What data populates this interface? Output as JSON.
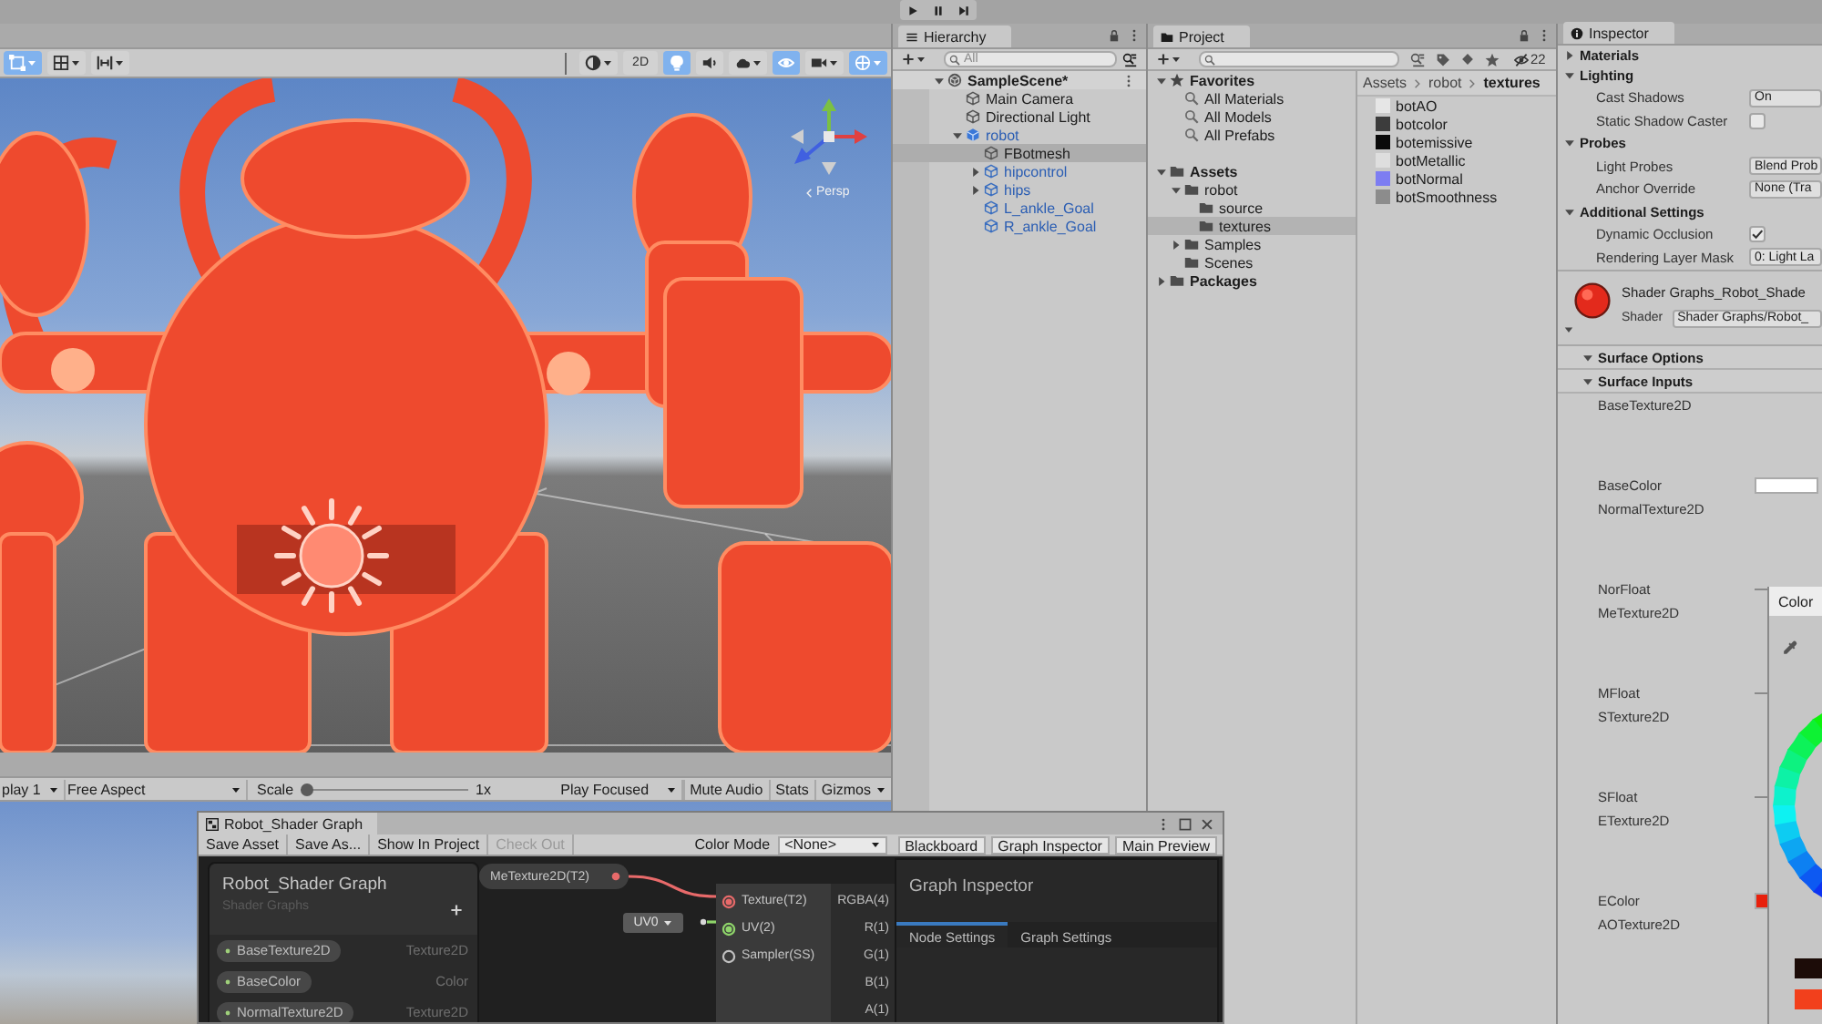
{
  "main_toolbar": {
    "play_buttons": [
      {
        "kind": "play",
        "selected": false
      },
      {
        "kind": "pause",
        "selected": false
      },
      {
        "kind": "step",
        "selected": false
      }
    ]
  },
  "scene_view": {
    "toolbar": {
      "left_tools": [
        {
          "kind": "rect",
          "selected": true
        },
        {
          "kind": "grid",
          "selected": false
        },
        {
          "kind": "snap",
          "selected": false
        }
      ],
      "right_tools": [
        {
          "kind": "shading",
          "selected": false
        },
        {
          "kind": "dimension",
          "label": "2D",
          "selected": false
        },
        {
          "kind": "lighting",
          "selected": true
        },
        {
          "kind": "audio",
          "selected": false
        },
        {
          "kind": "effects",
          "selected": false
        },
        {
          "kind": "visibility",
          "selected": true
        },
        {
          "kind": "camera",
          "selected": false
        },
        {
          "kind": "gizmos",
          "selected": true
        }
      ]
    },
    "projection": "Persp"
  },
  "game_view": {
    "toolbar": {
      "display": "play 1",
      "aspect": "Free Aspect",
      "scale": {
        "label": "Scale",
        "level": 0,
        "value": "1x"
      },
      "play_mode": "Play Focused",
      "buttons": [
        {
          "label": "Mute Audio",
          "kind": "toggle"
        },
        {
          "label": "Stats",
          "kind": "toggle"
        },
        {
          "label": "Gizmos",
          "kind": "dropdown"
        }
      ]
    }
  },
  "hierarchy": {
    "title": "Hierarchy",
    "search": {
      "placeholder": "All"
    },
    "items": [
      {
        "name": "SampleScene*",
        "kind": "scene",
        "expanded": true,
        "selected": false,
        "children": [
          {
            "name": "Main Camera",
            "kind": "object",
            "selected": false
          },
          {
            "name": "Directional Light",
            "kind": "object",
            "selected": false
          },
          {
            "name": "robot",
            "kind": "prefab",
            "expanded": true,
            "selected": false,
            "children": [
              {
                "name": "FBotmesh",
                "kind": "object",
                "selected": true
              },
              {
                "name": "hipcontrol",
                "kind": "nested",
                "expanded": false,
                "selected": false
              },
              {
                "name": "hips",
                "kind": "nested",
                "expanded": false,
                "selected": false
              },
              {
                "name": "L_ankle_Goal",
                "kind": "nested",
                "selected": false
              },
              {
                "name": "R_ankle_Goal",
                "kind": "nested",
                "selected": false
              }
            ]
          }
        ]
      }
    ]
  },
  "project": {
    "title": "Project",
    "hidden_count": "22",
    "tree": [
      {
        "name": "Favorites",
        "kind": "favorites",
        "expanded": true,
        "selected": false,
        "children": [
          {
            "name": "All Materials",
            "kind": "search",
            "selected": false
          },
          {
            "name": "All Models",
            "kind": "search",
            "selected": false
          },
          {
            "name": "All Prefabs",
            "kind": "search",
            "selected": false
          }
        ]
      },
      {
        "name": "Assets",
        "kind": "folder",
        "expanded": true,
        "selected": false,
        "children": [
          {
            "name": "robot",
            "kind": "folder",
            "expanded": true,
            "selected": false,
            "children": [
              {
                "name": "source",
                "kind": "folder",
                "selected": false
              },
              {
                "name": "textures",
                "kind": "folder",
                "selected": true
              }
            ]
          },
          {
            "name": "Samples",
            "kind": "folder",
            "expanded": false,
            "selected": false
          },
          {
            "name": "Scenes",
            "kind": "folder",
            "selected": false
          }
        ]
      },
      {
        "name": "Packages",
        "kind": "folder",
        "expanded": false,
        "selected": false
      }
    ],
    "breadcrumb": [
      "Assets",
      "robot",
      "textures"
    ],
    "files": [
      {
        "name": "botAO",
        "color": "#e6e6e6",
        "selected": false
      },
      {
        "name": "botcolor",
        "color": "#3c3c3c",
        "selected": false
      },
      {
        "name": "botemissive",
        "color": "#0a0a0a",
        "selected": false
      },
      {
        "name": "botMetallic",
        "color": "#dedede",
        "selected": false
      },
      {
        "name": "botNormal",
        "color": "#7d7df2",
        "selected": false
      },
      {
        "name": "botSmoothness",
        "color": "#8c8c8c",
        "selected": false
      }
    ]
  },
  "inspector": {
    "title": "Inspector",
    "sections": [
      {
        "title": "Materials",
        "expanded": false
      },
      {
        "title": "Lighting",
        "expanded": true,
        "rows": [
          {
            "label": "Cast Shadows",
            "kind": "dropdown",
            "value": "On"
          },
          {
            "label": "Static Shadow Caster",
            "kind": "checkbox",
            "checked": false
          }
        ]
      },
      {
        "title": "Probes",
        "expanded": true,
        "rows": [
          {
            "label": "Light Probes",
            "kind": "dropdown",
            "value": "Blend Prob"
          },
          {
            "label": "Anchor Override",
            "kind": "dropdown",
            "value": "None (Tra"
          }
        ]
      },
      {
        "title": "Additional Settings",
        "expanded": true,
        "rows": [
          {
            "label": "Dynamic Occlusion",
            "kind": "checkbox",
            "checked": true
          },
          {
            "label": "Rendering Layer Mask",
            "kind": "dropdown",
            "value": "0: Light La"
          }
        ]
      }
    ],
    "material": {
      "name": "Shader Graphs_Robot_Shade",
      "shader_label": "Shader",
      "shader": "Shader Graphs/Robot_",
      "expanded": true
    },
    "material_sections": [
      {
        "title": "Surface Options",
        "expanded": true
      },
      {
        "title": "Surface Inputs",
        "expanded": true,
        "properties": [
          {
            "label": "BaseTexture2D",
            "kind": "texture"
          },
          {
            "label": "BaseColor",
            "kind": "color",
            "color": "#ffffff"
          },
          {
            "label": "NormalTexture2D",
            "kind": "texture"
          },
          {
            "label": "NorFloat",
            "kind": "float"
          },
          {
            "label": "MeTexture2D",
            "kind": "texture"
          },
          {
            "label": "MFloat",
            "kind": "float"
          },
          {
            "label": "STexture2D",
            "kind": "texture"
          },
          {
            "label": "SFloat",
            "kind": "float"
          },
          {
            "label": "ETexture2D",
            "kind": "texture"
          },
          {
            "label": "EColor",
            "kind": "color",
            "color": "#e8200c"
          },
          {
            "label": "AOTexture2D",
            "kind": "texture"
          }
        ]
      }
    ]
  },
  "color_picker": {
    "title": "Color",
    "swatches": [
      {
        "color": "#1c0c08"
      },
      {
        "color": "#f2401c"
      }
    ]
  },
  "shader_graph": {
    "title": "Robot_Shader Graph",
    "toolbar": [
      {
        "label": "Save Asset",
        "disabled": false
      },
      {
        "label": "Save As...",
        "disabled": false
      },
      {
        "label": "Show In Project",
        "disabled": false
      },
      {
        "label": "Check Out",
        "disabled": true
      }
    ],
    "color_mode": {
      "label": "Color Mode",
      "value": "<None>"
    },
    "panels": [
      "Blackboard",
      "Graph Inspector",
      "Main Preview"
    ],
    "blackboard": {
      "title": "Robot_Shader Graph",
      "subtitle": "Shader Graphs",
      "properties": [
        {
          "name": "BaseTexture2D",
          "type": "Texture2D"
        },
        {
          "name": "BaseColor",
          "type": "Color"
        },
        {
          "name": "NormalTexture2D",
          "type": "Texture2D"
        }
      ]
    },
    "property_node": {
      "label": "MeTexture2D(T2)",
      "color": "#e86a6a"
    },
    "uv_dropdown": {
      "value": "UV0"
    },
    "sample_node": {
      "inputs": [
        {
          "label": "Texture(T2)",
          "connected": true,
          "color": "#e86a6a"
        },
        {
          "label": "UV(2)",
          "connected": true,
          "color": "#8ed46a"
        },
        {
          "label": "Sampler(SS)",
          "connected": false,
          "color": "#c0c0c0"
        }
      ],
      "outputs": [
        "RGBA(4)",
        "R(1)",
        "G(1)",
        "B(1)",
        "A(1)"
      ]
    },
    "graph_inspector": {
      "title": "Graph Inspector",
      "tabs": [
        {
          "label": "Node Settings",
          "selected": true
        },
        {
          "label": "Graph Settings",
          "selected": false
        }
      ]
    }
  }
}
